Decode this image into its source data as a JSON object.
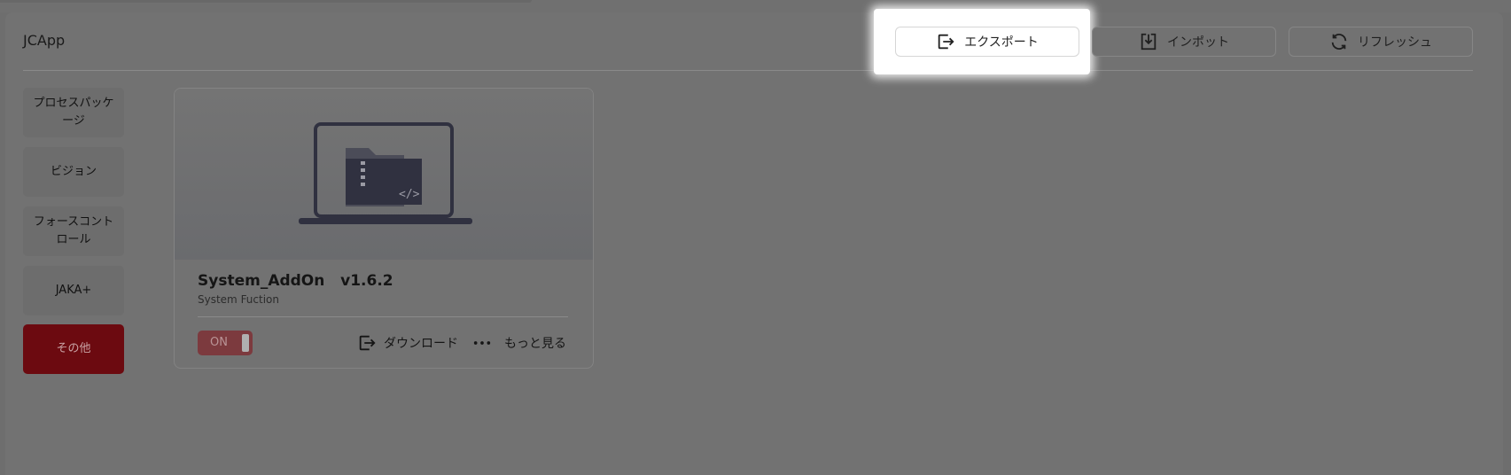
{
  "app": {
    "title": "JCApp"
  },
  "toolbar": {
    "export_label": "エクスポート",
    "import_label": "インポット",
    "refresh_label": "リフレッシュ"
  },
  "sidebar": {
    "items": [
      {
        "label": "プロセスパッケージ"
      },
      {
        "label": "ビジョン"
      },
      {
        "label": "フォースコントロール"
      },
      {
        "label": "JAKA+"
      },
      {
        "label": "その他",
        "selected": true
      }
    ]
  },
  "card": {
    "name": "System_AddOn",
    "version": "v1.6.2",
    "description": "System Fuction",
    "toggle_label": "ON",
    "download_label": "ダウンロード",
    "more_label": "もっと見る",
    "more_icon": "ellipsis-icon"
  },
  "colors": {
    "accent": "#6c0a10",
    "overlay": "#727272",
    "highlight": "#ffffff"
  }
}
